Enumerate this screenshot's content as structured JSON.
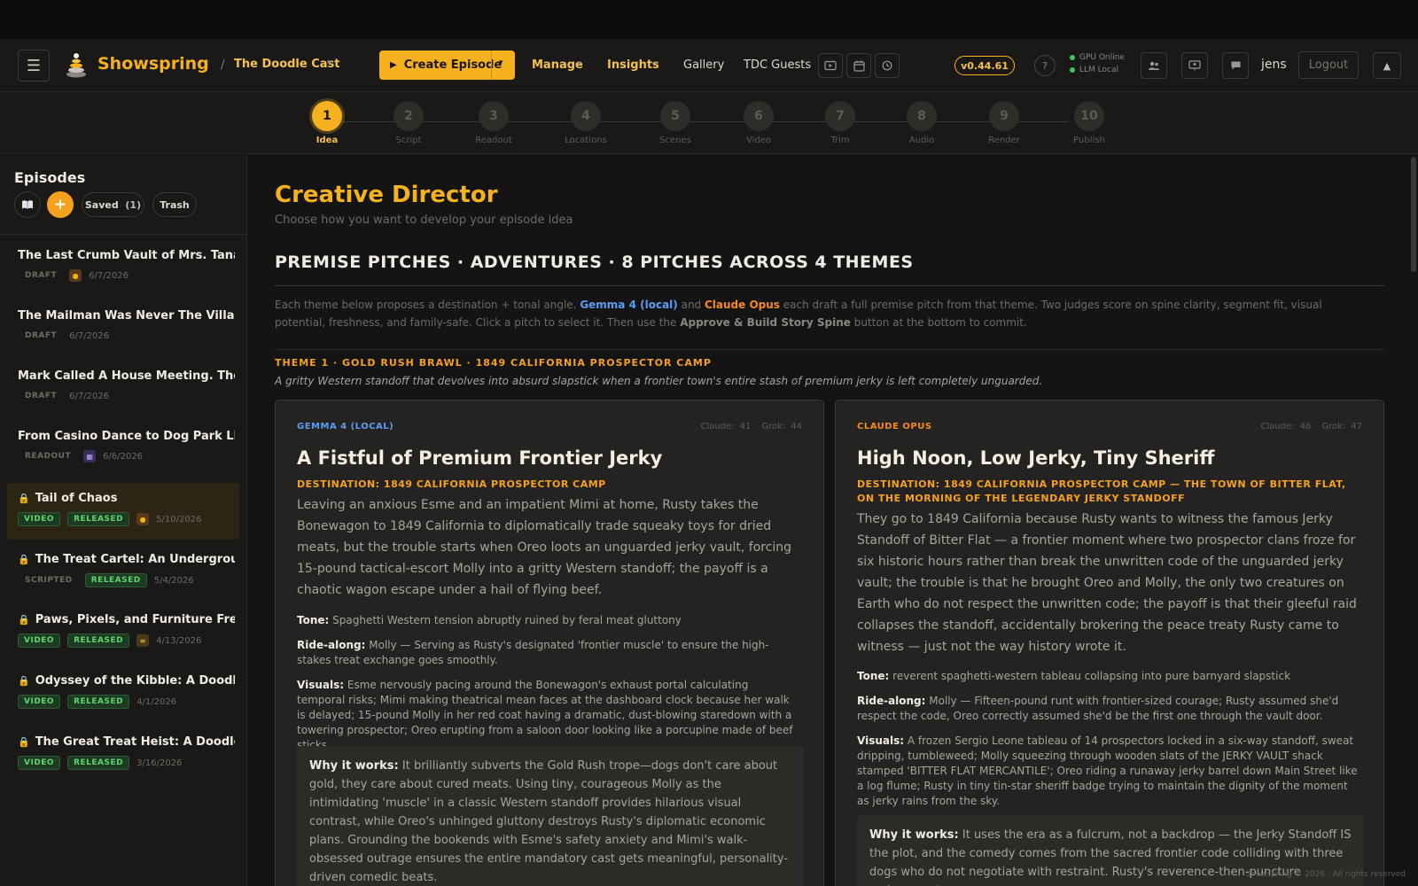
{
  "app": {
    "logo_text": "Showspring",
    "breadcrumb": "The Doodle Cast",
    "version": "v0.44.61",
    "user": "jens",
    "logout": "Logout",
    "help": "?",
    "status": [
      "GPU Online",
      "LLM Local"
    ]
  },
  "nav": {
    "create_label": "Create Episode",
    "links": [
      "Manage",
      "Insights",
      "Gallery",
      "TDC Guests"
    ]
  },
  "steps": [
    {
      "n": "1",
      "label": "Idea"
    },
    {
      "n": "2",
      "label": "Script"
    },
    {
      "n": "3",
      "label": "Readout"
    },
    {
      "n": "4",
      "label": "Locations"
    },
    {
      "n": "5",
      "label": "Scenes"
    },
    {
      "n": "6",
      "label": "Video"
    },
    {
      "n": "7",
      "label": "Trim"
    },
    {
      "n": "8",
      "label": "Audio"
    },
    {
      "n": "9",
      "label": "Render"
    },
    {
      "n": "10",
      "label": "Publish"
    }
  ],
  "sidebar": {
    "title": "Episodes",
    "add": "+",
    "saved": "Saved",
    "saved_count": "(1)",
    "trash": "Trash",
    "episodes": [
      {
        "title": "The Last Crumb Vault of Mrs. Tanaka",
        "status": "DRAFT",
        "date": "6/7/2026"
      },
      {
        "title": "The Mailman Was Never The Villain",
        "status": "DRAFT",
        "date": "6/7/2026"
      },
      {
        "title": "Mark Called A House Meeting. The ...",
        "status": "DRAFT",
        "date": "6/7/2026"
      },
      {
        "title": "From Casino Dance to Dog Park Lin...",
        "status": "READOUT",
        "date": "6/6/2026"
      },
      {
        "title": "Tail of Chaos",
        "status": "VIDEO",
        "release": "RELEASED",
        "date": "5/10/2026"
      },
      {
        "title": "The Treat Cartel: An Undergroun...",
        "status": "SCRIPTED",
        "release": "RELEASED",
        "date": "5/4/2026"
      },
      {
        "title": "Paws, Pixels, and Furniture Frenzy",
        "status": "VIDEO",
        "release": "RELEASED",
        "date": "4/13/2026"
      },
      {
        "title": "Odyssey of the Kibble: A Doodle...",
        "status": "VIDEO",
        "release": "RELEASED",
        "date": "4/1/2026"
      },
      {
        "title": "The Great Treat Heist: A Doodle ...",
        "status": "VIDEO",
        "release": "RELEASED",
        "date": "3/16/2026"
      }
    ]
  },
  "main": {
    "title": "Creative Director",
    "subtitle": "Choose how you want to develop your episode idea",
    "section_title": "PREMISE PITCHES · ADVENTURES · 8 PITCHES ACROSS 4 THEMES",
    "intro": {
      "p1": "Each theme below proposes a destination + tonal angle.",
      "gemma": "Gemma 4 (local)",
      "and": "and",
      "opus": "Claude Opus",
      "p2": "each draft a full premise pitch from that theme. Two judges score on spine clarity, segment fit, visual potential, freshness, and family-safe. Click a pitch to select it. Then use the",
      "button_ref": "Approve & Build Story Spine",
      "p3": "button at the bottom to commit."
    },
    "theme_title": "THEME 1 · GOLD RUSH BRAWL · 1849 CALIFORNIA PROSPECTOR CAMP",
    "theme_desc": "A gritty Western standoff that devolves into absurd slapstick when a frontier town's entire stash of premium jerky is left completely unguarded.",
    "cards": [
      {
        "model": "GEMMA 4 (LOCAL)",
        "claude_label": "Claude:",
        "claude": "41",
        "grok_label": "Grok:",
        "grok": "44",
        "title": "A Fistful of Premium Frontier Jerky",
        "dest": "DESTINATION: 1849 CALIFORNIA PROSPECTOR CAMP",
        "body": "Leaving an anxious Esme and an impatient Mimi at home, Rusty takes the Bonewagon to 1849 California to diplomatically trade squeaky toys for dried meats, but the trouble starts when Oreo loots an unguarded jerky vault, forcing 15-pound tactical-escort Molly into a gritty Western standoff; the payoff is a chaotic wagon escape under a hail of flying beef.",
        "tone_label": "Tone:",
        "tone": "Spaghetti Western tension abruptly ruined by feral meat gluttony",
        "ride_label": "Ride-along:",
        "ride": "Molly — Serving as Rusty's designated 'frontier muscle' to ensure the high-stakes treat exchange goes smoothly.",
        "visuals_label": "Visuals:",
        "visuals": "Esme nervously pacing around the Bonewagon's exhaust portal calculating temporal risks; Mimi making theatrical mean faces at the dashboard clock because her walk is delayed; 15-pound Molly in her red coat having a dramatic, dust-blowing staredown with a towering prospector; Oreo erupting from a saloon door looking like a porcupine made of beef sticks.",
        "why_label": "Why it works:",
        "why": "It brilliantly subverts the Gold Rush trope—dogs don't care about gold, they care about cured meats. Using tiny, courageous Molly as the intimidating 'muscle' in a classic Western standoff provides hilarious visual contrast, while Oreo's unhinged gluttony destroys Rusty's diplomatic economic plans. Grounding the bookends with Esme's safety anxiety and Mimi's walk-obsessed outrage ensures the entire mandatory cast gets meaningful, personality-driven comedic beats."
      },
      {
        "model": "CLAUDE OPUS",
        "claude_label": "Claude:",
        "claude": "46",
        "grok_label": "Grok:",
        "grok": "47",
        "title": "High Noon, Low Jerky, Tiny Sheriff",
        "dest": "DESTINATION: 1849 CALIFORNIA PROSPECTOR CAMP — THE TOWN OF BITTER FLAT, ON THE MORNING OF THE LEGENDARY JERKY STANDOFF",
        "body": "They go to 1849 California because Rusty wants to witness the famous Jerky Standoff of Bitter Flat — a frontier moment where two prospector clans froze for six historic hours rather than break the unwritten code of the unguarded jerky vault; the trouble is that he brought Oreo and Molly, the only two creatures on Earth who do not respect the unwritten code; the payoff is that their gleeful raid collapses the standoff, accidentally brokering the peace treaty Rusty came to witness — just not the way history wrote it.",
        "tone_label": "Tone:",
        "tone": "reverent spaghetti-western tableau collapsing into pure barnyard slapstick",
        "ride_label": "Ride-along:",
        "ride": "Molly — Fifteen-pound runt with frontier-sized courage; Rusty assumed she'd respect the code, Oreo correctly assumed she'd be the first one through the vault door.",
        "visuals_label": "Visuals:",
        "visuals": "A frozen Sergio Leone tableau of 14 prospectors locked in a six-way standoff, sweat dripping, tumbleweed; Molly squeezing through wooden slats of the JERKY VAULT shack stamped 'BITTER FLAT MERCANTILE'; Oreo riding a runaway jerky barrel down Main Street like a log flume; Rusty in tiny tin-star sheriff badge trying to maintain the dignity of the moment as jerky rains from the sky.",
        "why_label": "Why it works:",
        "why": "It uses the era as a fulcrum, not a backdrop — the Jerky Standoff IS the plot, and the comedy comes from the sacred frontier code colliding with three dogs who do not negotiate with restraint. Rusty's reverence-then-puncture cadence gets a"
      }
    ],
    "footer": "Showspring © 2026 · All rights reserved"
  }
}
